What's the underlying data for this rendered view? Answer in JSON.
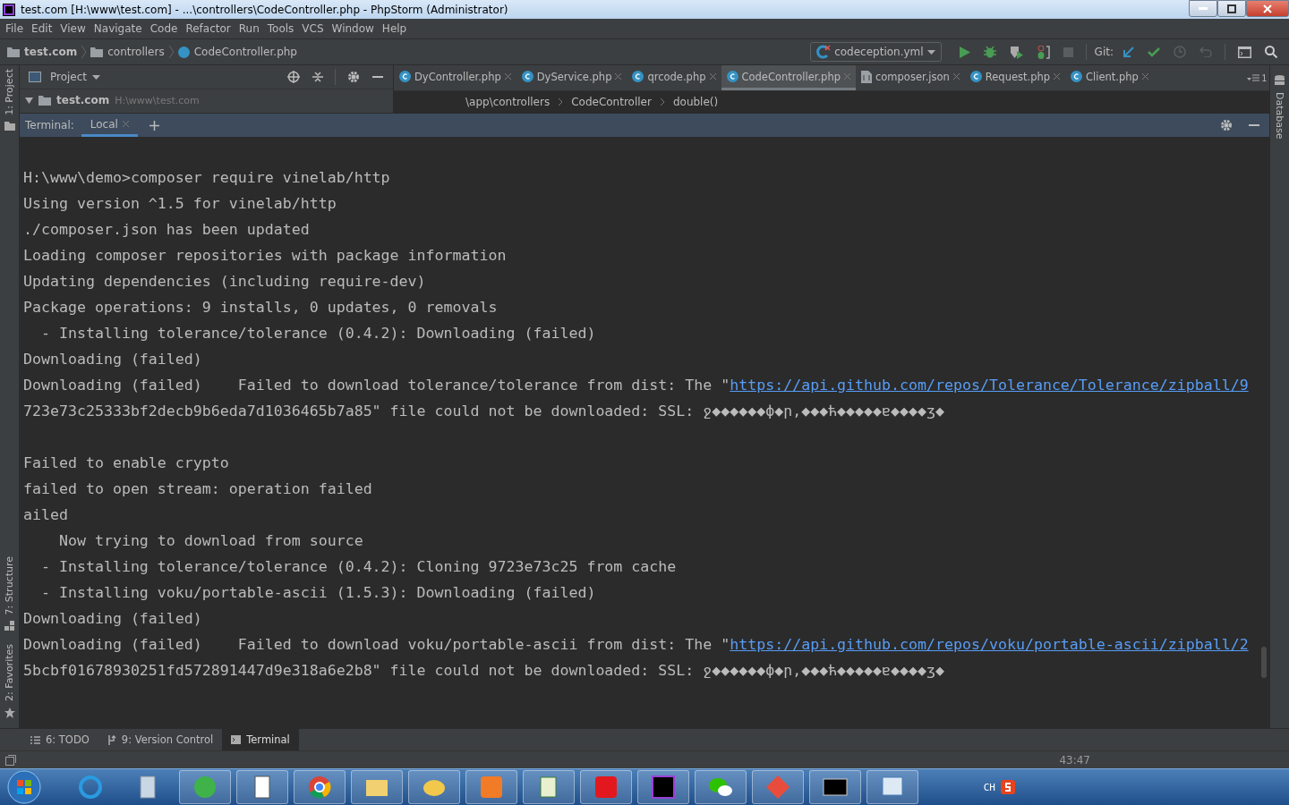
{
  "window": {
    "title": "test.com [H:\\www\\test.com] - ...\\controllers\\CodeController.php - PhpStorm (Administrator)"
  },
  "menu": [
    "File",
    "Edit",
    "View",
    "Navigate",
    "Code",
    "Refactor",
    "Run",
    "Tools",
    "VCS",
    "Window",
    "Help"
  ],
  "navbar": {
    "crumbs": [
      {
        "label": "test.com",
        "kind": "folder"
      },
      {
        "label": "controllers",
        "kind": "folder"
      },
      {
        "label": "CodeController.php",
        "kind": "class"
      }
    ],
    "run_config": "codeception.yml",
    "git_label": "Git:"
  },
  "left_strip": {
    "top": [
      "1: Project"
    ],
    "bottom": [
      "7: Structure",
      "2: Favorites"
    ]
  },
  "project_panel": {
    "title": "Project",
    "root": {
      "name": "test.com",
      "path": "H:\\www\\test.com",
      "expanded": true
    }
  },
  "editor_tabs": [
    {
      "label": "DyController.php",
      "kind": "class",
      "selected": false
    },
    {
      "label": "DyService.php",
      "kind": "class",
      "selected": false
    },
    {
      "label": "qrcode.php",
      "kind": "class",
      "selected": false
    },
    {
      "label": "CodeController.php",
      "kind": "class",
      "selected": true
    },
    {
      "label": "composer.json",
      "kind": "json",
      "selected": false
    },
    {
      "label": "Request.php",
      "kind": "class",
      "selected": false
    },
    {
      "label": "Client.php",
      "kind": "class",
      "selected": false
    }
  ],
  "tab_overflow": "1",
  "breadcrumb": [
    "\\app\\controllers",
    "CodeController",
    "double()"
  ],
  "right_strip": [
    "Database"
  ],
  "terminal": {
    "label": "Terminal:",
    "tabs": [
      {
        "label": "Local",
        "selected": true
      }
    ],
    "lines": [
      {
        "kind": "blank"
      },
      {
        "kind": "output",
        "text": "H:\\www\\demo>composer require vinelab/http"
      },
      {
        "kind": "output",
        "text": "Using version ^1.5 for vinelab/http"
      },
      {
        "kind": "output",
        "text": "./composer.json has been updated"
      },
      {
        "kind": "output",
        "text": "Loading composer repositories with package information"
      },
      {
        "kind": "output",
        "text": "Updating dependencies (including require-dev)"
      },
      {
        "kind": "output",
        "text": "Package operations: 9 installs, 0 updates, 0 removals"
      },
      {
        "kind": "output",
        "text": "  - Installing tolerance/tolerance (0.4.2): Downloading (failed)"
      },
      {
        "kind": "output",
        "text": "Downloading (failed)"
      },
      {
        "kind": "output",
        "text": "Downloading (failed)    Failed to download tolerance/tolerance from dist: The \"",
        "link": "https://api.github.com/repos/Tolerance/Tolerance/zipball/9"
      },
      {
        "kind": "output",
        "text": "723e73c25333bf2decb9b6eda7d1036465b7a85\" file could not be downloaded: SSL: ջ◆◆◆◆◆◆ф◆ր,◆◆◆ћ◆◆◆◆◆ɐ◆◆◆◆ʒ◆"
      },
      {
        "kind": "blank"
      },
      {
        "kind": "output",
        "text": "Failed to enable crypto"
      },
      {
        "kind": "output",
        "text": "failed to open stream: operation failed"
      },
      {
        "kind": "output",
        "text": "ailed"
      },
      {
        "kind": "output",
        "text": "    Now trying to download from source"
      },
      {
        "kind": "output",
        "text": "  - Installing tolerance/tolerance (0.4.2): Cloning 9723e73c25 from cache"
      },
      {
        "kind": "output",
        "text": "  - Installing voku/portable-ascii (1.5.3): Downloading (failed)"
      },
      {
        "kind": "output",
        "text": "Downloading (failed)"
      },
      {
        "kind": "output",
        "text": "Downloading (failed)    Failed to download voku/portable-ascii from dist: The \"",
        "link": "https://api.github.com/repos/voku/portable-ascii/zipball/2"
      },
      {
        "kind": "output",
        "text": "5bcbf01678930251fd572891447d9e318a6e2b8\" file could not be downloaded: SSL: ջ◆◆◆◆◆◆ф◆ր,◆◆◆ћ◆◆◆◆◆ɐ◆◆◆◆ʒ◆"
      }
    ]
  },
  "bottom_tabs": [
    {
      "label": "6: TODO",
      "kind": "list",
      "selected": false
    },
    {
      "label": "9: Version Control",
      "kind": "vcs",
      "selected": false
    },
    {
      "label": "Terminal",
      "kind": "terminal",
      "selected": true
    }
  ],
  "status_bar": {
    "position": "43:47"
  },
  "taskbar": {
    "tray_language": "CH"
  }
}
